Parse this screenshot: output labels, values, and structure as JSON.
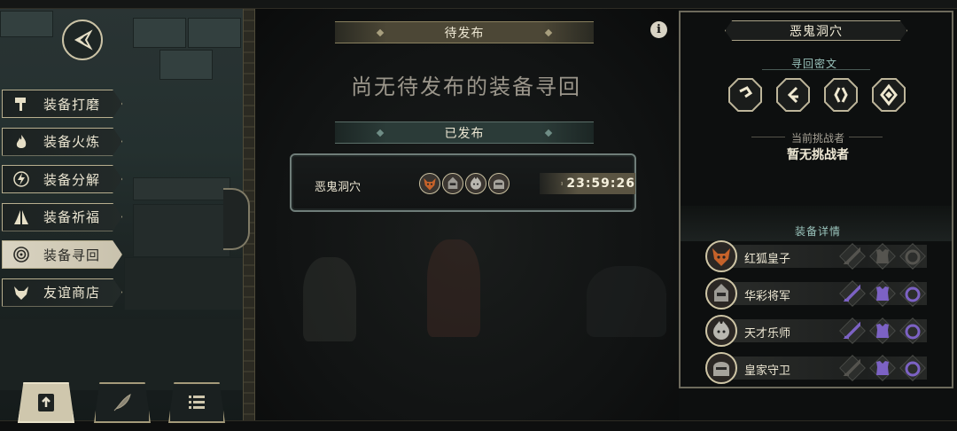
{
  "colors": {
    "accent_gold": "#cbc3a6",
    "accent_teal": "#9bc5bd",
    "equip_active": "#7c62c4",
    "equip_inactive": "#55544f"
  },
  "nav": {
    "back_icon": "emblem-back-icon",
    "menu": [
      {
        "label": "装备打磨",
        "icon": "hammer-icon",
        "active": false
      },
      {
        "label": "装备火炼",
        "icon": "flame-icon",
        "active": false
      },
      {
        "label": "装备分解",
        "icon": "lightning-icon",
        "active": false
      },
      {
        "label": "装备祈福",
        "icon": "pray-hands-icon",
        "active": false
      },
      {
        "label": "装备寻回",
        "icon": "spiral-icon",
        "active": true
      },
      {
        "label": "友谊商店",
        "icon": "fox-emblem-icon",
        "active": false
      }
    ],
    "bottom_buttons": [
      {
        "icon": "publish-upload-icon",
        "active": true
      },
      {
        "icon": "feather-icon",
        "active": false
      },
      {
        "icon": "list-icon",
        "active": false
      }
    ]
  },
  "main": {
    "info_symbol": "i",
    "pending_header": "待发布",
    "pending_empty": "尚无待发布的装备寻回",
    "published_header": "已发布",
    "published": [
      {
        "name": "恶鬼洞穴",
        "avatars": [
          "fox-emperor-avatar",
          "general-avatar",
          "musician-avatar",
          "guard-avatar"
        ],
        "timer": "23:59:26"
      }
    ]
  },
  "detail": {
    "title": "恶鬼洞穴",
    "cipher_label": "寻回密文",
    "ciphers": [
      "cipher-rune-1-icon",
      "cipher-rune-2-icon",
      "cipher-rune-3-icon",
      "cipher-rune-4-icon"
    ],
    "challenger_label": "当前挑战者",
    "challenger_value": "暂无挑战者",
    "equipment_label": "装备详情",
    "heroes": [
      {
        "name": "红狐皇子",
        "avatar": "fox-emperor-avatar",
        "equip": [
          false,
          false,
          false
        ]
      },
      {
        "name": "华彩将军",
        "avatar": "general-avatar",
        "equip": [
          true,
          true,
          true
        ]
      },
      {
        "name": "天才乐师",
        "avatar": "musician-avatar",
        "equip": [
          true,
          true,
          true
        ]
      },
      {
        "name": "皇家守卫",
        "avatar": "guard-avatar",
        "equip": [
          false,
          true,
          true
        ]
      }
    ]
  }
}
